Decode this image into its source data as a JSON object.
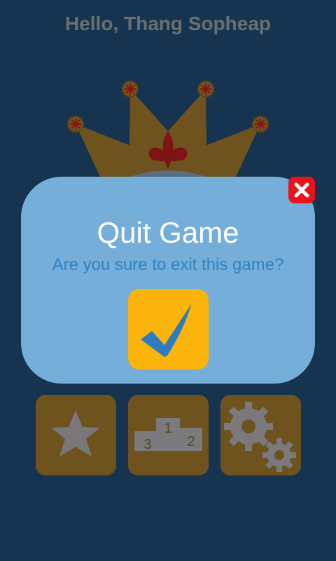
{
  "header": {
    "greeting": "Hello, Thang Sopheap"
  },
  "dialog": {
    "title": "Quit Game",
    "message": "Are you sure to exit this game?",
    "confirm_icon": "checkmark-icon",
    "close_icon": "close-x-icon"
  },
  "menu": {
    "buttons": [
      {
        "icon": "star-icon"
      },
      {
        "icon": "podium-icon",
        "places": [
          "1",
          "2",
          "3"
        ]
      },
      {
        "icon": "gears-icon"
      }
    ]
  },
  "colors": {
    "background": "#16344f",
    "dialog": "#75aed9",
    "message": "#2f83c4",
    "confirm": "#fbb40b",
    "close": "#e8131b",
    "dimmed_button": "#6e531f"
  }
}
